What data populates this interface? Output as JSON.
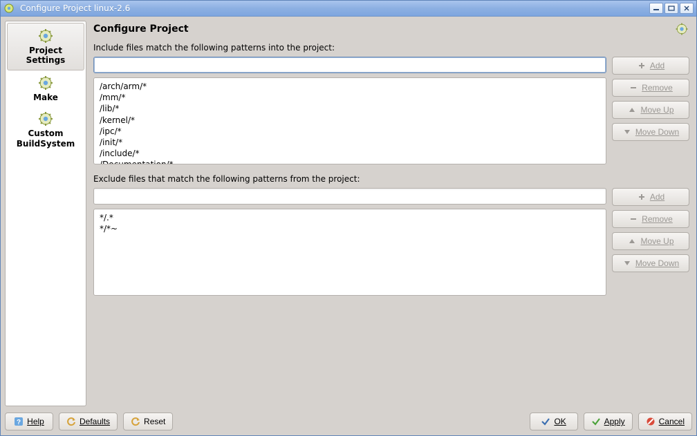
{
  "window": {
    "title": "Configure Project linux-2.6"
  },
  "sidebar": {
    "items": [
      {
        "label": "Project\nSettings"
      },
      {
        "label": "Make"
      },
      {
        "label": "Custom\nBuildSystem"
      }
    ],
    "selected": 0
  },
  "page": {
    "title": "Configure Project",
    "include_label": "Include files match the following patterns into the project:",
    "exclude_label": "Exclude files that match the following patterns from the project:",
    "include_input": "",
    "exclude_input": "",
    "include_patterns": [
      "/arch/arm/*",
      "/mm/*",
      "/lib/*",
      "/kernel/*",
      "/ipc/*",
      "/init/*",
      "/include/*",
      "/Documentation/*"
    ],
    "exclude_patterns": [
      "*/.*",
      "*/*~"
    ],
    "buttons": {
      "add": "Add",
      "remove": "Remove",
      "move_up": "Move Up",
      "move_down": "Move Down"
    }
  },
  "footer": {
    "help": "Help",
    "defaults": "Defaults",
    "reset": "Reset",
    "ok": "OK",
    "apply": "Apply",
    "cancel": "Cancel"
  }
}
